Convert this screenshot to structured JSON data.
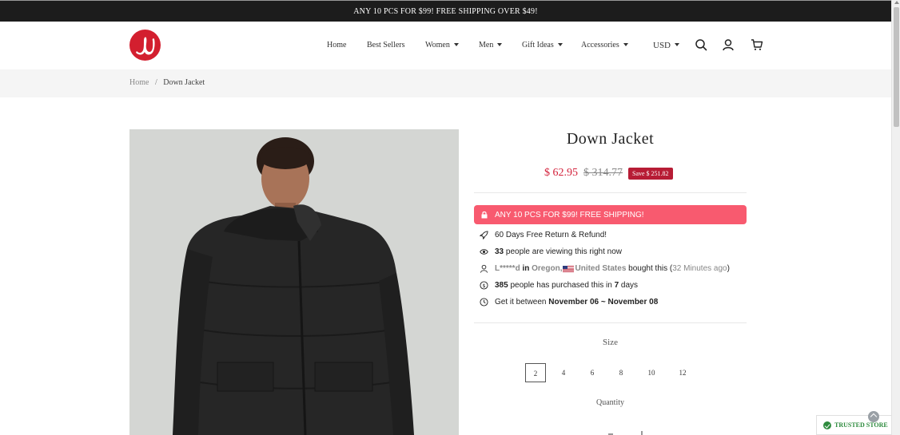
{
  "announcement": "ANY 10 PCS FOR $99! FREE SHIPPING OVER $49!",
  "header": {
    "logo_icon": "lululemon-logo-icon",
    "nav": [
      {
        "label": "Home",
        "dropdown": false
      },
      {
        "label": "Best Sellers",
        "dropdown": false
      },
      {
        "label": "Women",
        "dropdown": true
      },
      {
        "label": "Men",
        "dropdown": true
      },
      {
        "label": "Gift Ideas",
        "dropdown": true
      },
      {
        "label": "Accessories",
        "dropdown": true
      }
    ],
    "currency": "USD",
    "icons": [
      "search-icon",
      "account-icon",
      "cart-icon"
    ]
  },
  "breadcrumb": {
    "home": "Home",
    "separator": "/",
    "current": "Down Jacket"
  },
  "product": {
    "title": "Down Jacket",
    "price": "$ 62.95",
    "compare_price": "$ 314.77",
    "save_badge": "Save $ 251.82",
    "promo": "ANY 10 PCS FOR $99! FREE SHIPPING!",
    "info": {
      "returns": "60 Days Free Return & Refund!",
      "viewing_count": "33",
      "viewing_text": "people are viewing this right now",
      "buyer_name": "L*****d",
      "buyer_in": "in",
      "buyer_state": "Oregon,",
      "buyer_country": "United States",
      "buyer_bought": "bought this (",
      "buyer_time": "32 Minutes ago",
      "buyer_close": ")",
      "purchased_count": "385",
      "purchased_text": "people has purchased this in",
      "purchased_days": "7",
      "purchased_unit": "days",
      "delivery_prefix": "Get it between",
      "delivery_range": "November 06 ~ November 08"
    },
    "size_label": "Size",
    "sizes": [
      "2",
      "4",
      "6",
      "8",
      "10",
      "12"
    ],
    "selected_size": "2",
    "quantity_label": "Quantity"
  },
  "trust_badge": "TRUSTED STORE",
  "colors": {
    "accent": "#d3203a",
    "promo": "#f85a6f",
    "badge": "#b71c35",
    "announcement_bg": "#1c1c1c",
    "trusted": "#2e8b3e"
  }
}
